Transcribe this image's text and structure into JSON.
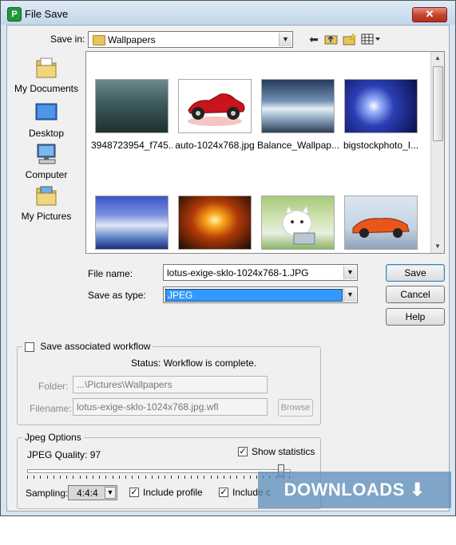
{
  "window": {
    "title": "File Save",
    "close_glyph": "✕",
    "app_icon_text": "P"
  },
  "toolbar": {
    "save_in_label": "Save in:",
    "save_in_value": "Wallpapers",
    "icons": [
      "back-arrow-icon",
      "up-folder-icon",
      "new-folder-icon",
      "view-menu-icon"
    ]
  },
  "places": [
    {
      "label": "My Documents",
      "icon": "documents-folder-icon"
    },
    {
      "label": "Desktop",
      "icon": "desktop-icon"
    },
    {
      "label": "Computer",
      "icon": "computer-icon"
    },
    {
      "label": "My Pictures",
      "icon": "pictures-folder-icon"
    }
  ],
  "files": [
    {
      "name": "3948723954_f745..."
    },
    {
      "name": "auto-1024x768.jpg"
    },
    {
      "name": "Balance_Wallpap..."
    },
    {
      "name": "bigstockphoto_I..."
    },
    {
      "name": ""
    },
    {
      "name": ""
    },
    {
      "name": ""
    },
    {
      "name": ""
    }
  ],
  "form": {
    "file_name_label": "File name:",
    "file_name_value": "lotus-exige-sklo-1024x768-1.JPG",
    "save_as_type_label": "Save as type:",
    "save_as_type_value": "JPEG"
  },
  "buttons": {
    "save": "Save",
    "cancel": "Cancel",
    "help": "Help"
  },
  "workflow": {
    "checkbox_label": "Save associated workflow",
    "checked": false,
    "status": "Status: Workflow is complete.",
    "folder_label": "Folder:",
    "folder_value": "...\\Pictures\\Wallpapers",
    "filename_label": "Filename:",
    "filename_value": "lotus-exige-sklo-1024x768.jpg.wfl",
    "browse_label": "Browse"
  },
  "jpeg": {
    "group_title": "Jpeg Options",
    "quality_label": "JPEG Quality: 97",
    "quality": 97,
    "show_statistics_label": "Show statistics",
    "show_statistics": true,
    "sampling_label": "Sampling:",
    "sampling_value": "4:4:4",
    "include_profile_label": "Include profile",
    "include_profile": true,
    "include_comments_label": "Include c",
    "include_comments": true
  },
  "watermark": "DOWNLOADS  ⬇ .GURU"
}
